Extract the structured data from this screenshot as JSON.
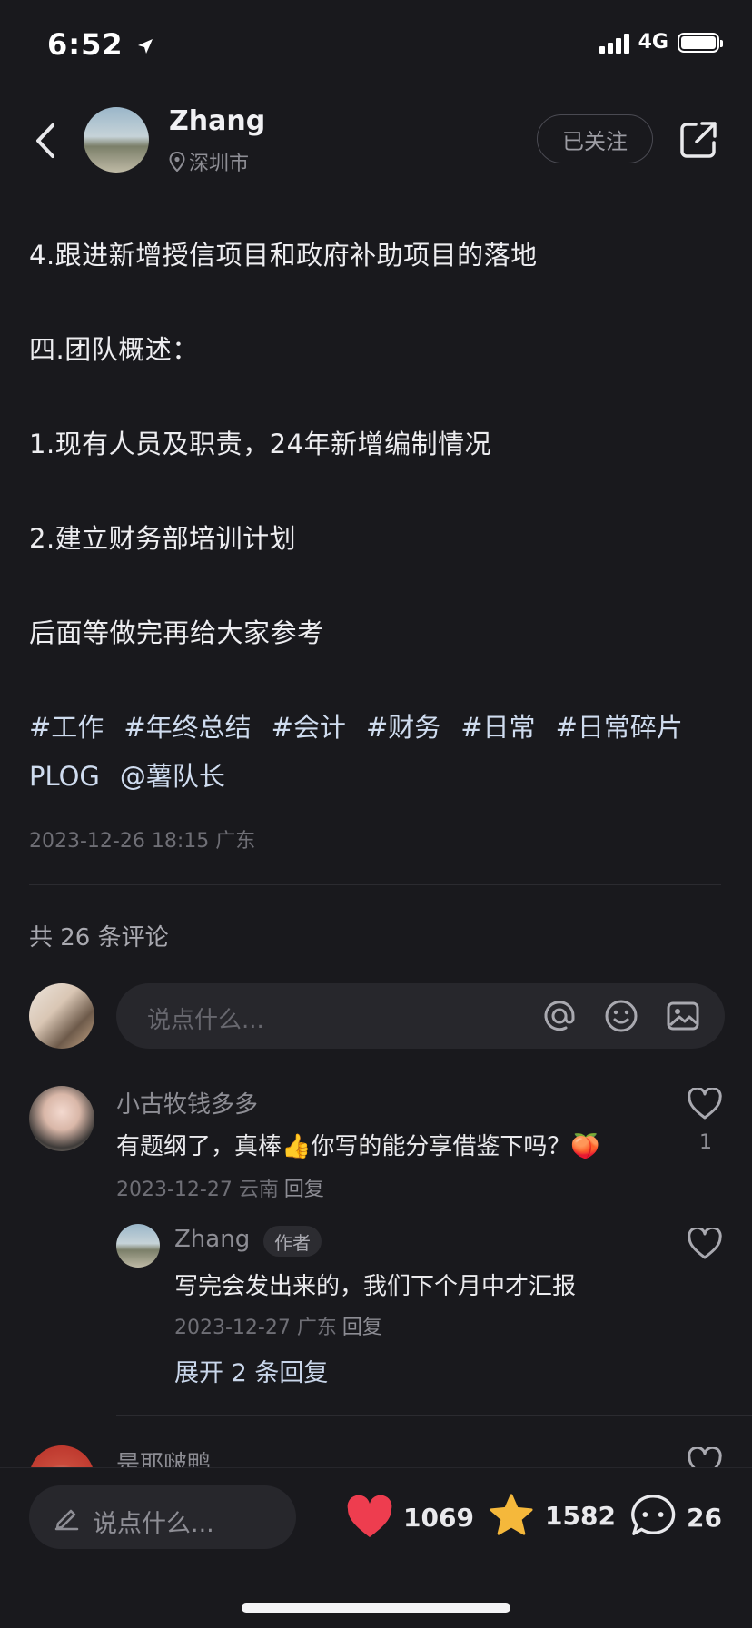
{
  "status_bar": {
    "time": "6:52",
    "network": "4G"
  },
  "header": {
    "author_name": "Zhang",
    "location": "深圳市",
    "follow_label": "已关注"
  },
  "post": {
    "lines": [
      "4.跟进新增授信项目和政府补助项目的落地",
      "四.团队概述：",
      "1.现有人员及职责，24年新增编制情况",
      "2.建立财务部培训计划",
      "后面等做完再给大家参考"
    ],
    "tags": [
      "#工作",
      "#年终总结",
      "#会计",
      "#财务",
      "#日常",
      "#日常碎片PLOG",
      "@薯队长"
    ],
    "date": "2023-12-26 18:15 广东"
  },
  "comments": {
    "count_label": "共 26 条评论",
    "input_placeholder": "说点什么...",
    "reply_label": "回复",
    "items": [
      {
        "name": "小古牧钱多多",
        "text": "有题纲了，真棒👍你写的能分享借鉴下吗？🍑",
        "meta": "2023-12-27 云南",
        "likes": "1",
        "reply": {
          "name": "Zhang",
          "badge": "作者",
          "text": "写完会发出来的，我们下个月中才汇报",
          "meta": "2023-12-27 广东"
        },
        "expand_label": "展开 2 条回复"
      },
      {
        "name": "是耶啵鸭"
      }
    ]
  },
  "bottom_bar": {
    "placeholder": "说点什么...",
    "likes": "1069",
    "stars": "1582",
    "comments": "26"
  },
  "colors": {
    "background": "#19191d",
    "heart": "#ee3d4f",
    "star": "#f5b83b",
    "tag": "#cfdcef"
  }
}
